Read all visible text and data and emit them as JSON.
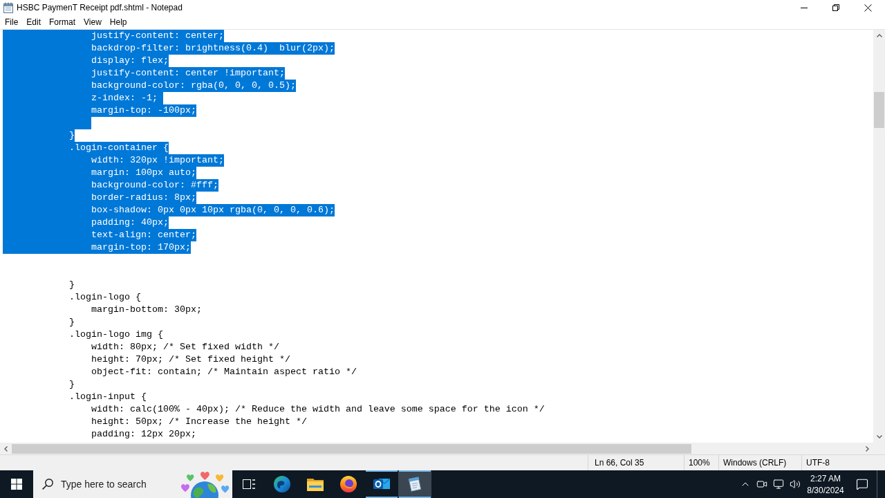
{
  "window": {
    "title": "HSBC PaymenT Receipt pdf.shtml - Notepad"
  },
  "menu": [
    "File",
    "Edit",
    "Format",
    "View",
    "Help"
  ],
  "editor": {
    "lines": [
      {
        "kind": "code",
        "text": "                justify-content: center;",
        "selected": true
      },
      {
        "kind": "code",
        "text": "                backdrop-filter: brightness(0.4)  blur(2px);",
        "selected": true
      },
      {
        "kind": "code",
        "text": "                display: flex;",
        "selected": true
      },
      {
        "kind": "code",
        "text": "                justify-content: center !important;",
        "selected": true
      },
      {
        "kind": "code",
        "text": "                background-color: rgba(0, 0, 0, 0.5);",
        "selected": true
      },
      {
        "kind": "code",
        "text": "                z-index: -1; ",
        "selected": true
      },
      {
        "kind": "code",
        "text": "                margin-top: -100px;",
        "selected": true
      },
      {
        "kind": "blank",
        "selected": true
      },
      {
        "kind": "code",
        "text": "            }",
        "selected": true
      },
      {
        "kind": "code",
        "text": "            .login-container {",
        "selected": true
      },
      {
        "kind": "code",
        "text": "                width: 320px !important;",
        "selected": true
      },
      {
        "kind": "code",
        "text": "                margin: 100px auto;",
        "selected": true
      },
      {
        "kind": "code",
        "text": "                background-color: #fff;",
        "selected": true
      },
      {
        "kind": "code",
        "text": "                border-radius: 8px;",
        "selected": true
      },
      {
        "kind": "code",
        "text": "                box-shadow: 0px 0px 10px rgba(0, 0, 0, 0.6);",
        "selected": true
      },
      {
        "kind": "code",
        "text": "                padding: 40px;",
        "selected": true
      },
      {
        "kind": "code",
        "text": "                text-align: center;",
        "selected": true
      },
      {
        "kind": "code",
        "text": "                margin-top: 170px;",
        "selected": true
      },
      {
        "kind": "blank",
        "selected": false
      },
      {
        "kind": "blank",
        "selected": false
      },
      {
        "kind": "code",
        "text": "            }",
        "selected": false
      },
      {
        "kind": "code",
        "text": "            .login-logo {",
        "selected": false
      },
      {
        "kind": "code",
        "text": "                margin-bottom: 30px;",
        "selected": false
      },
      {
        "kind": "code",
        "text": "            }",
        "selected": false
      },
      {
        "kind": "code",
        "text": "            .login-logo img {",
        "selected": false
      },
      {
        "kind": "code",
        "text": "                width: 80px; /* Set fixed width */",
        "selected": false
      },
      {
        "kind": "code",
        "text": "                height: 70px; /* Set fixed height */",
        "selected": false
      },
      {
        "kind": "code",
        "text": "                object-fit: contain; /* Maintain aspect ratio */",
        "selected": false
      },
      {
        "kind": "code",
        "text": "            }",
        "selected": false
      },
      {
        "kind": "code",
        "text": "            .login-input {",
        "selected": false
      },
      {
        "kind": "code",
        "text": "                width: calc(100% - 40px); /* Reduce the width and leave some space for the icon */",
        "selected": false
      },
      {
        "kind": "code",
        "text": "                height: 50px; /* Increase the height */",
        "selected": false
      },
      {
        "kind": "code",
        "text": "                padding: 12px 20px;",
        "selected": false
      }
    ]
  },
  "status_bar": {
    "position": "Ln 66, Col 35",
    "zoom": "100%",
    "line_ending": "Windows (CRLF)",
    "encoding": "UTF-8"
  },
  "taskbar": {
    "search": {
      "placeholder": "Type here to search"
    },
    "apps": [
      {
        "kind": "task_view",
        "running": false,
        "selected": false
      },
      {
        "kind": "browser",
        "running": false,
        "selected": false
      },
      {
        "kind": "folder",
        "running": false,
        "selected": false
      },
      {
        "kind": "firefox",
        "running": false,
        "selected": false
      },
      {
        "kind": "mail",
        "running": true,
        "selected": false
      },
      {
        "kind": "notepad",
        "running": true,
        "selected": true
      }
    ],
    "clock": {
      "time": "2:27 AM",
      "date": "8/30/2024"
    }
  }
}
